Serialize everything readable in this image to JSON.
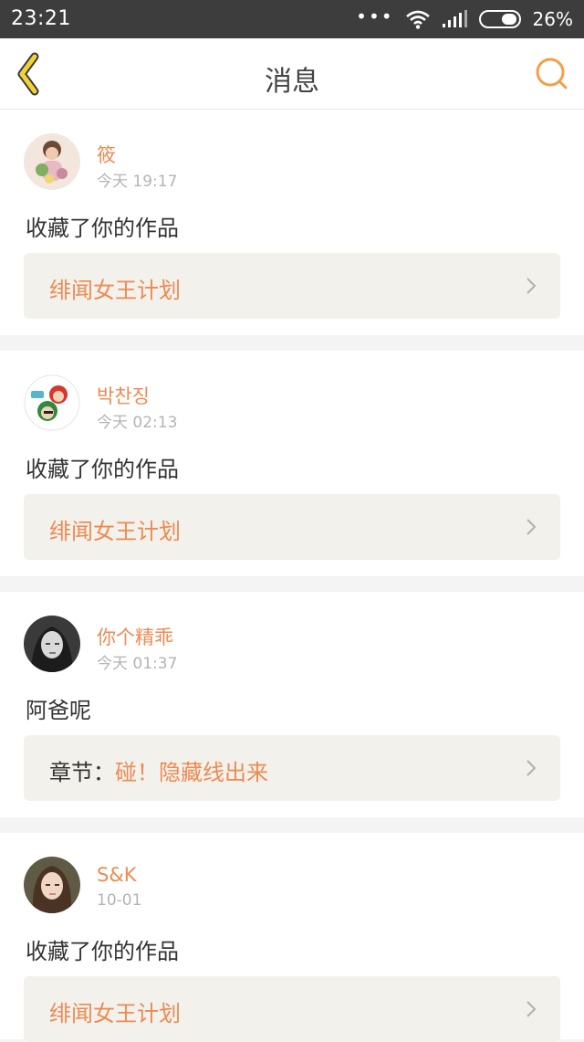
{
  "status_bar": {
    "time": "23:21",
    "dots": "•••",
    "battery": "26%"
  },
  "header": {
    "title": "消息",
    "accent_color": "#f0a04b"
  },
  "notifications": [
    {
      "username": "筱",
      "time": "今天 19:17",
      "message": "收藏了你的作品",
      "link_prefix": "",
      "link_text": "绯闻女王计划",
      "avatar": "avatar-flowers"
    },
    {
      "username": "박찬징",
      "time": "今天 02:13",
      "message": "收藏了你的作品",
      "link_prefix": "",
      "link_text": "绯闻女王计划",
      "avatar": "avatar-cartoon"
    },
    {
      "username": "你个精乖",
      "time": "今天 01:37",
      "message": "阿爸呢",
      "link_prefix": "章节：",
      "link_text": "碰！隐藏线出来",
      "avatar": "avatar-bw-portrait"
    },
    {
      "username": "S&K",
      "time": "10-01",
      "message": "收藏了你的作品",
      "link_prefix": "",
      "link_text": "绯闻女王计划",
      "avatar": "avatar-portrait"
    }
  ],
  "colors": {
    "username": "#ee8a52",
    "link_background": "#f2f1ec",
    "status_bar": "#3d3d3d"
  }
}
